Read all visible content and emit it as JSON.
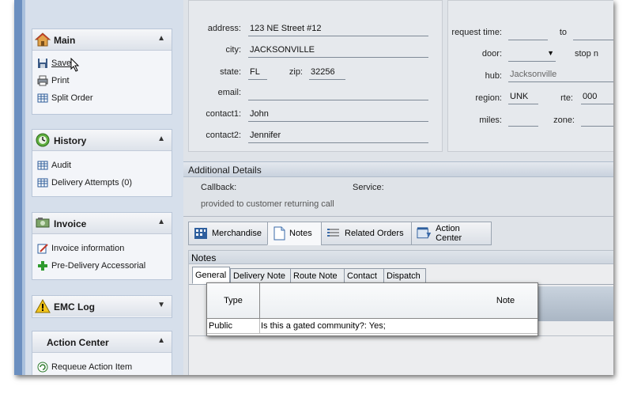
{
  "sidebar": {
    "main": {
      "title": "Main",
      "items": [
        {
          "label": "Save",
          "icon": "save-icon"
        },
        {
          "label": "Print",
          "icon": "print-icon"
        },
        {
          "label": "Split Order",
          "icon": "grid-icon"
        }
      ]
    },
    "history": {
      "title": "History",
      "items": [
        {
          "label": "Audit",
          "icon": "grid-icon"
        },
        {
          "label": "Delivery Attempts (0)",
          "icon": "grid-icon"
        }
      ]
    },
    "invoice": {
      "title": "Invoice",
      "items": [
        {
          "label": "Invoice information",
          "icon": "edit-icon"
        },
        {
          "label": "Pre-Delivery Accessorial",
          "icon": "plus-icon"
        }
      ]
    },
    "emc_log": {
      "title": "EMC Log"
    },
    "action_center": {
      "title": "Action Center",
      "items": [
        {
          "label": "Requeue Action Item",
          "icon": "requeue-icon"
        }
      ]
    }
  },
  "address_form": {
    "address_label": "address:",
    "address_value": "123 NE Street #12",
    "city_label": "city:",
    "city_value": "JACKSONVILLE",
    "state_label": "state:",
    "state_value": "FL",
    "zip_label": "zip:",
    "zip_value": "32256",
    "email_label": "email:",
    "email_value": "",
    "contact1_label": "contact1:",
    "contact1_value": "John",
    "contact2_label": "contact2:",
    "contact2_value": "Jennifer"
  },
  "schedule_form": {
    "request_time_label": "request time:",
    "to_label": "to",
    "door_label": "door:",
    "stop_label": "stop n",
    "hub_label": "hub:",
    "hub_value": "Jacksonville",
    "region_label": "region:",
    "region_value": "UNK",
    "rte_label": "rte:",
    "rte_value": "000",
    "miles_label": "miles:",
    "zone_label": "zone:"
  },
  "additional_details": {
    "title": "Additional Details",
    "callback_label": "Callback:",
    "service_label": "Service:",
    "note": "provided to customer returning call"
  },
  "tabs": [
    {
      "label": "Merchandise",
      "icon": "merchandise-icon"
    },
    {
      "label": "Notes",
      "icon": "notes-icon"
    },
    {
      "label": "Related Orders",
      "icon": "related-orders-icon"
    },
    {
      "label": "Action Center",
      "icon": "action-center-icon"
    }
  ],
  "notes": {
    "title": "Notes",
    "subtabs": [
      "General",
      "Delivery Note",
      "Route Note",
      "Contact",
      "Dispatch"
    ],
    "columns": [
      "Type",
      "Note"
    ],
    "rows": [
      {
        "type": "Public",
        "note": "Is this a gated community?: Yes;"
      }
    ]
  }
}
